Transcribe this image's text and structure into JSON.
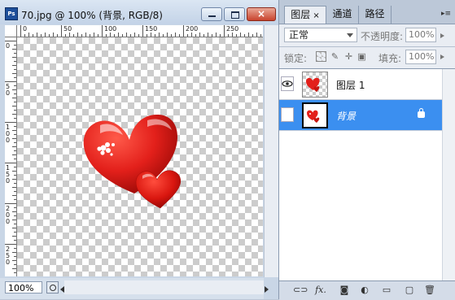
{
  "document": {
    "title": "70.jpg @ 100% (背景, RGB/8)",
    "zoom": "100%",
    "close_label": "×",
    "hruler_labels": [
      "0",
      "50",
      "100",
      "150",
      "200",
      "250"
    ],
    "vruler_labels": [
      "0",
      "5\n0",
      "1\n0\n0",
      "1\n5\n0",
      "2\n0\n0",
      "2\n5\n0"
    ]
  },
  "panel": {
    "tabs": {
      "layers": "图层",
      "channels": "通道",
      "paths": "路径",
      "close": "×"
    },
    "menu_glyph": "▸≡",
    "blend_mode": "正常",
    "opacity_label": "不透明度:",
    "opacity_value": "100%",
    "lock_label": "锁定:",
    "fill_label": "填充:",
    "fill_value": "100%",
    "layers": [
      {
        "name": "图层 1",
        "visible": true,
        "selected": false
      },
      {
        "name": "背景",
        "visible": false,
        "selected": true,
        "locked": true
      }
    ],
    "bottom_icons": [
      "link-icon",
      "fx-icon",
      "mask-icon",
      "adjustment-icon",
      "folder-icon",
      "new-layer-icon",
      "trash-icon"
    ]
  },
  "colors": {
    "selection": "#3b8ff0",
    "heart_red": "#e3201b"
  }
}
